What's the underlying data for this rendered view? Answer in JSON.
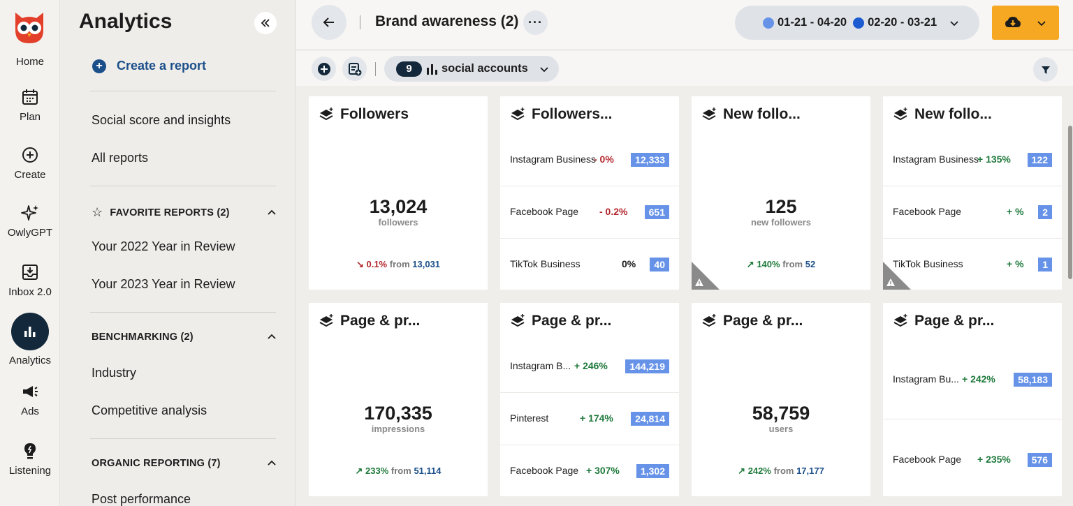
{
  "rail": {
    "items": [
      {
        "label": "Home"
      },
      {
        "label": "Plan"
      },
      {
        "label": "Create"
      },
      {
        "label": "OwlyGPT"
      },
      {
        "label": "Inbox 2.0"
      },
      {
        "label": "Analytics"
      },
      {
        "label": "Ads"
      },
      {
        "label": "Listening"
      }
    ]
  },
  "sidebar": {
    "title": "Analytics",
    "create_report": "Create a report",
    "links": [
      "Social score and insights",
      "All reports"
    ],
    "favorites": {
      "label": "FAVORITE REPORTS (2)",
      "items": [
        "Your 2022 Year in Review",
        "Your 2023 Year in Review"
      ]
    },
    "benchmarking": {
      "label": "BENCHMARKING (2)",
      "items": [
        "Industry",
        "Competitive analysis"
      ]
    },
    "organic": {
      "label": "ORGANIC REPORTING (7)",
      "items": [
        "Post performance"
      ]
    }
  },
  "header": {
    "title": "Brand awareness (2)",
    "more": "···",
    "date_range_1": "01-21 - 04-20",
    "date_range_2": "02-20 - 03-21",
    "date_color_1": "#6693e8",
    "date_color_2": "#1c5bd0",
    "export_color": "#f7a823"
  },
  "subbar": {
    "accounts_count": "9",
    "accounts_label": "social accounts"
  },
  "cards": [
    {
      "title": "Followers",
      "value": "13,024",
      "unit": "followers",
      "change": "0.1%",
      "from_label": "from",
      "from": "13,031"
    },
    {
      "title": "Followers...",
      "rows": [
        {
          "label": "Instagram Business",
          "change": "- 0%",
          "value": "12,333"
        },
        {
          "label": "Facebook Page",
          "change": "- 0.2%",
          "value": "651"
        },
        {
          "label": "TikTok Business",
          "change": "0%",
          "value": "40"
        }
      ]
    },
    {
      "title": "New follo...",
      "value": "125",
      "unit": "new followers",
      "change": "140%",
      "from_label": "from",
      "from": "52"
    },
    {
      "title": "New follo...",
      "rows": [
        {
          "label": "Instagram Business",
          "change": "+ 135%",
          "value": "122"
        },
        {
          "label": "Facebook Page",
          "change": "+ %",
          "value": "2"
        },
        {
          "label": "TikTok Business",
          "change": "+ %",
          "value": "1"
        }
      ]
    },
    {
      "title": "Page & pr...",
      "value": "170,335",
      "unit": "impressions",
      "change": "233%",
      "from_label": "from",
      "from": "51,114"
    },
    {
      "title": "Page & pr...",
      "rows": [
        {
          "label": "Instagram B...",
          "change": "+ 246%",
          "value": "144,219"
        },
        {
          "label": "Pinterest",
          "change": "+ 174%",
          "value": "24,814"
        },
        {
          "label": "Facebook Page",
          "change": "+ 307%",
          "value": "1,302"
        }
      ]
    },
    {
      "title": "Page & pr...",
      "value": "58,759",
      "unit": "users",
      "change": "242%",
      "from_label": "from",
      "from": "17,177"
    },
    {
      "title": "Page & pr...",
      "rows": [
        {
          "label": "Instagram Bu...",
          "change": "+ 242%",
          "value": "58,183"
        },
        {
          "label": "Facebook Page",
          "change": "+ 235%",
          "value": "576"
        }
      ]
    }
  ]
}
